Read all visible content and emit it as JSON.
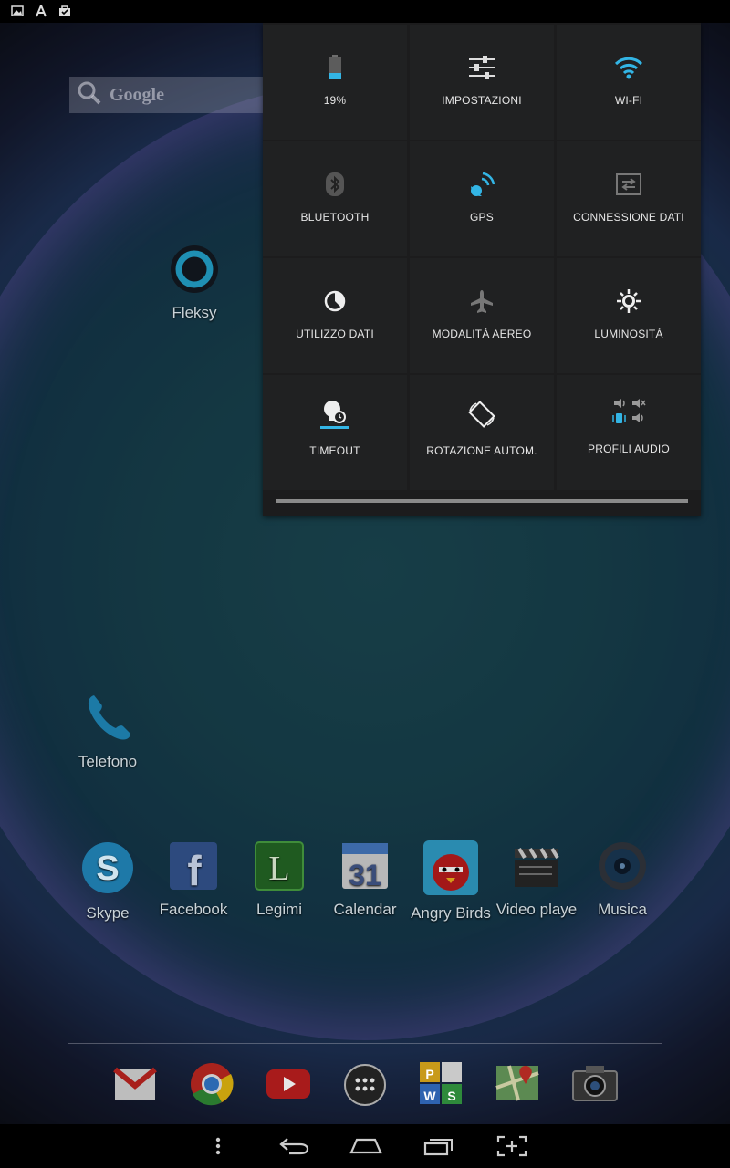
{
  "colors": {
    "accent": "#33b5e5",
    "panel_bg": "#1c1c1d",
    "tile_bg": "#202122"
  },
  "statusbar": {
    "icons": [
      "image-icon",
      "font-icon",
      "shopping-bag-icon"
    ]
  },
  "search": {
    "text": "Google"
  },
  "home": {
    "fleksy": "Fleksy",
    "telefono": "Telefono",
    "apps": [
      "Skype",
      "Facebook",
      "Legimi",
      "Calendar",
      "Angry Birds",
      "Video playe",
      "Musica"
    ],
    "calendar_day": "31"
  },
  "quick_settings": {
    "battery": "19%",
    "impostazioni": "IMPOSTAZIONI",
    "wifi": "WI-FI",
    "bluetooth": "BLUETOOTH",
    "gps": "GPS",
    "connessione": "CONNESSIONE DATI",
    "utilizzo": "UTILIZZO DATI",
    "aereo": "MODALITÀ AEREO",
    "luminosita": "LUMINOSITÀ",
    "timeout": "TIMEOUT",
    "rotazione": "ROTAZIONE AUTOM.",
    "profili": "PROFILI AUDIO"
  },
  "dock": [
    "gmail-icon",
    "chrome-icon",
    "youtube-icon",
    "apps-drawer-icon",
    "wordfeud-icon",
    "maps-icon",
    "camera-icon"
  ],
  "navbar": [
    "menu-icon",
    "back-icon",
    "home-icon",
    "recents-icon",
    "screenshot-icon"
  ]
}
